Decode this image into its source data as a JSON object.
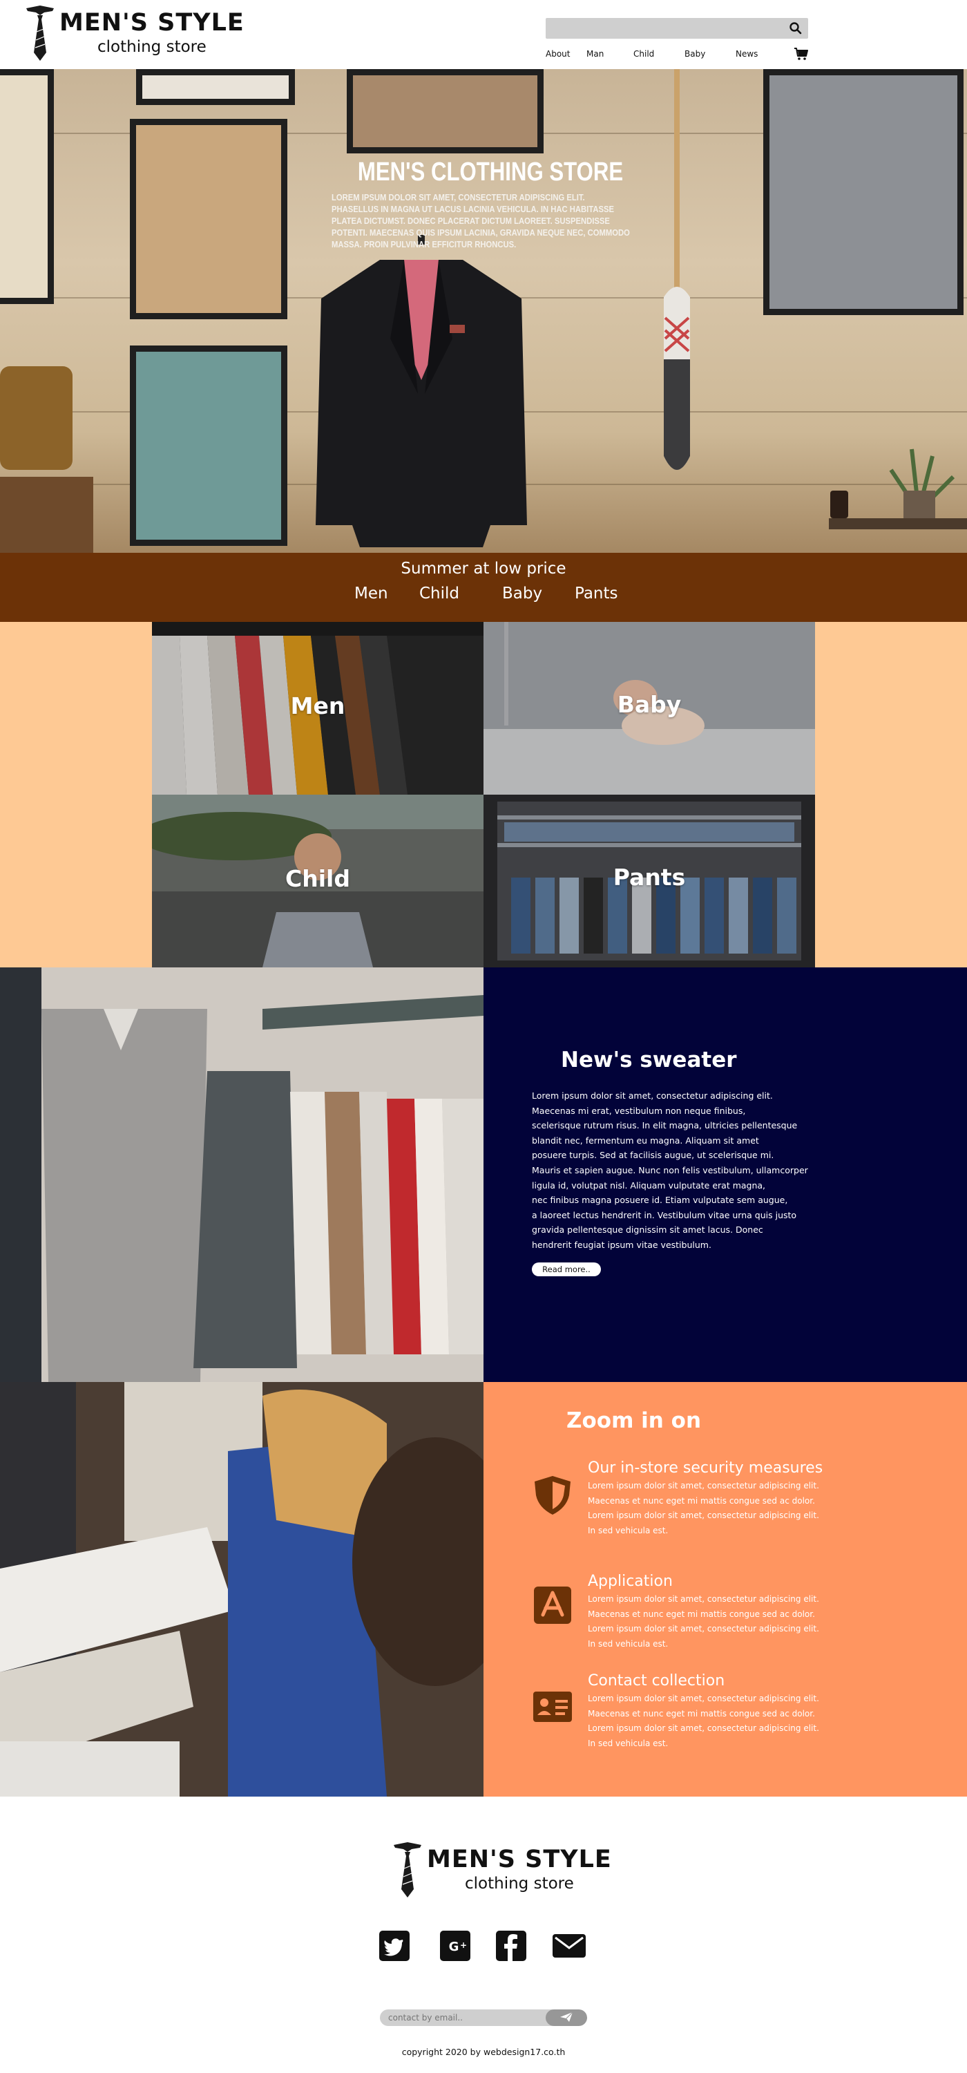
{
  "brand": {
    "name": "MEN'S STYLE",
    "tagline": "clothing store"
  },
  "search": {
    "placeholder": "",
    "value": ""
  },
  "nav": {
    "items": [
      "About",
      "Man",
      "Child",
      "Baby",
      "News"
    ]
  },
  "hero": {
    "title": "MEN'S CLOTHING STORE",
    "text": "Lorem ipsum dolor sit amet, consectetur adipiscing elit. Phasellus in magna ut lacus lacinia vehicula. In hac habitasse platea dictumst. Donec placerat dictum laoreet. Suspendisse potenti. Maecenas quis ipsum lacinia, gravida neque nec, commodo massa. Proin pulvinar efficitur rhoncus."
  },
  "promo": {
    "title": "Summer at low price",
    "links": [
      "Men",
      "Child",
      "Baby",
      "Pants"
    ]
  },
  "categories": {
    "men": "Men",
    "baby": "Baby",
    "child": "Child",
    "pants": "Pants"
  },
  "sweater": {
    "title": "New's sweater",
    "lines": [
      "Lorem ipsum dolor sit amet, consectetur adipiscing elit.",
      "Maecenas mi erat, vestibulum non neque finibus,",
      "scelerisque rutrum risus. In elit magna, ultricies pellentesque",
      " blandit nec, fermentum eu magna. Aliquam sit amet",
      "posuere turpis. Sed at facilisis augue, ut scelerisque mi.",
      "Mauris et sapien augue. Nunc non felis vestibulum, ullamcorper",
      "ligula id, volutpat nisl. Aliquam vulputate erat magna,",
      "nec finibus magna posuere id. Etiam vulputate sem augue,",
      " a laoreet lectus hendrerit in. Vestibulum vitae urna quis justo",
      " gravida pellentesque dignissim sit amet lacus. Donec",
      "hendrerit feugiat ipsum vitae vestibulum."
    ],
    "read_more": "Read more.."
  },
  "zoom": {
    "title": "Zoom in on",
    "items": [
      {
        "title": "Our in-store security measures",
        "lines": [
          "Lorem ipsum dolor sit amet, consectetur adipiscing elit.",
          "Maecenas et nunc eget mi mattis congue sed ac dolor.",
          "Lorem ipsum dolor sit amet, consectetur adipiscing elit.",
          "In sed vehicula est."
        ]
      },
      {
        "title": "Application",
        "lines": [
          "Lorem ipsum dolor sit amet, consectetur adipiscing elit.",
          "Maecenas et nunc eget mi mattis congue sed ac dolor.",
          "Lorem ipsum dolor sit amet, consectetur adipiscing elit.",
          "In sed vehicula est."
        ]
      },
      {
        "title": "Contact collection",
        "lines": [
          "Lorem ipsum dolor sit amet, consectetur adipiscing elit.",
          "Maecenas et nunc eget mi mattis congue sed ac dolor.",
          "Lorem ipsum dolor sit amet, consectetur adipiscing elit.",
          "In sed vehicula est."
        ]
      }
    ]
  },
  "footer": {
    "email_placeholder": "contact by email..",
    "copyright": "copyright 2020 by webdesign17.co.th"
  },
  "icons": {
    "search": "search-icon",
    "cart": "cart-icon",
    "tie": "tie-logo-icon",
    "shield": "shield-icon",
    "app": "app-store-icon",
    "contact": "contact-card-icon",
    "twitter": "twitter-icon",
    "google_plus": "google-plus-icon",
    "facebook": "facebook-icon",
    "mail": "mail-icon",
    "send": "send-icon"
  },
  "colors": {
    "promo_band": "#6c3207",
    "category_bg": "#fec994",
    "sweater_panel": "#020339",
    "zoom_panel": "#ff9560",
    "zoom_icon": "#6c3207",
    "search_bg": "#cfcfcf"
  }
}
